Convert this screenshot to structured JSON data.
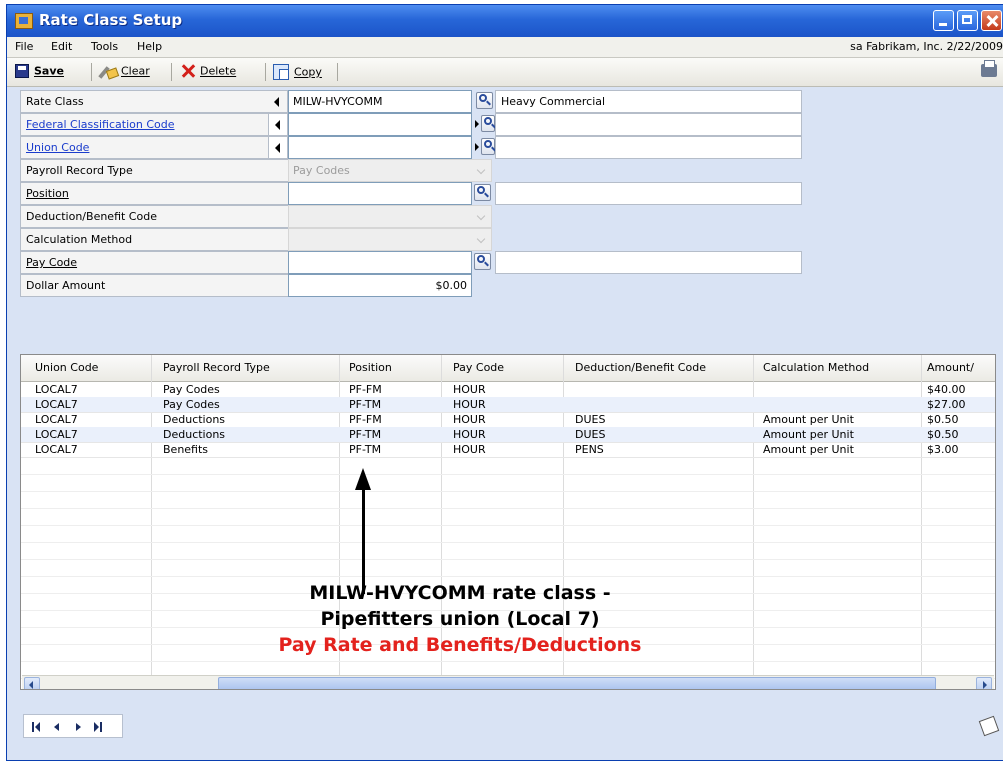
{
  "window": {
    "title": "Rate Class Setup"
  },
  "menu": {
    "items": [
      "File",
      "Edit",
      "Tools",
      "Help"
    ],
    "company_info": "sa  Fabrikam, Inc.  2/22/2009"
  },
  "toolbar": {
    "save": "Save",
    "clear": "Clear",
    "delete": "Delete",
    "copy": "Copy"
  },
  "form": {
    "rate_class": {
      "label": "Rate Class",
      "value": "MILW-HVYCOMM",
      "description": "Heavy Commercial"
    },
    "federal_classification": {
      "label": "Federal Classification Code",
      "value": "",
      "description": ""
    },
    "union_code": {
      "label": "Union Code",
      "value": "",
      "description": ""
    },
    "payroll_record_type": {
      "label": "Payroll Record Type",
      "value": "Pay Codes"
    },
    "position": {
      "label": "Position",
      "value": "",
      "description": ""
    },
    "deduction_benefit": {
      "label": "Deduction/Benefit Code",
      "value": ""
    },
    "calculation_method": {
      "label": "Calculation Method",
      "value": ""
    },
    "pay_code": {
      "label": "Pay Code",
      "value": "",
      "description": ""
    },
    "dollar_amount": {
      "label": "Dollar Amount",
      "value": "$0.00"
    }
  },
  "grid": {
    "headers": [
      "Union Code",
      "Payroll Record Type",
      "Position",
      "Pay Code",
      "Deduction/Benefit Code",
      "Calculation Method",
      "Amount/"
    ],
    "rows": [
      [
        "LOCAL7",
        "Pay Codes",
        "PF-FM",
        "HOUR",
        "",
        "",
        "$40.00"
      ],
      [
        "LOCAL7",
        "Pay Codes",
        "PF-TM",
        "HOUR",
        "",
        "",
        "$27.00"
      ],
      [
        "LOCAL7",
        "Deductions",
        "PF-FM",
        "HOUR",
        "DUES",
        "Amount per Unit",
        "$0.50"
      ],
      [
        "LOCAL7",
        "Deductions",
        "PF-TM",
        "HOUR",
        "DUES",
        "Amount per Unit",
        "$0.50"
      ],
      [
        "LOCAL7",
        "Benefits",
        "PF-TM",
        "HOUR",
        "PENS",
        "Amount per Unit",
        "$3.00"
      ]
    ]
  },
  "annotation": {
    "line1": "MILW-HVYCOMM rate class -",
    "line2": "Pipefitters union (Local 7)",
    "line3": "Pay Rate and Benefits/Deductions"
  },
  "colors": {
    "titlebar": "#2766d8",
    "annotation_red": "#e3221d",
    "link": "#1a3ccc"
  }
}
